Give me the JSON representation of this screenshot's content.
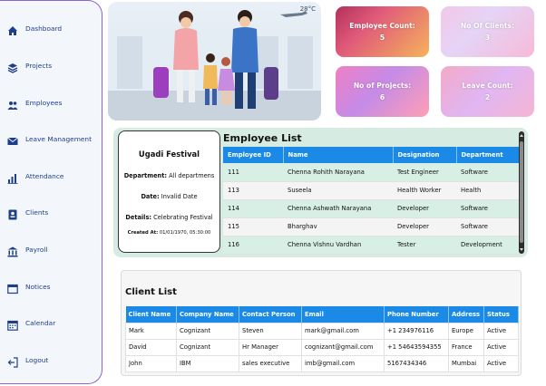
{
  "sidebar": {
    "items": [
      {
        "label": "Dashboard",
        "icon": "home-icon"
      },
      {
        "label": "Projects",
        "icon": "layers-icon"
      },
      {
        "label": "Employees",
        "icon": "users-icon"
      },
      {
        "label": "Leave Management",
        "icon": "envelope-icon"
      },
      {
        "label": "Attendance",
        "icon": "bar-chart-icon"
      },
      {
        "label": "Clients",
        "icon": "id-card-icon"
      },
      {
        "label": "Payroll",
        "icon": "bank-icon"
      },
      {
        "label": "Notices",
        "icon": "window-icon"
      },
      {
        "label": "Calendar",
        "icon": "calendar-icon"
      },
      {
        "label": "Logout",
        "icon": "logout-icon"
      }
    ]
  },
  "hero": {
    "temperature": "28°C"
  },
  "stats": [
    {
      "label": "Employee Count:",
      "value": "5"
    },
    {
      "label": "No Of Clients:",
      "value": "3"
    },
    {
      "label": "No of Projects:",
      "value": "6"
    },
    {
      "label": "Leave Count:",
      "value": "2"
    }
  ],
  "festival": {
    "title": "Ugadi Festival",
    "department_label": "Department:",
    "department": "All departmens",
    "date_label": "Date:",
    "date": "Invalid Date",
    "details_label": "Details:",
    "details": "Celebrating Festival",
    "created_label": "Created At:",
    "created": "01/01/1970, 05:30:00"
  },
  "employees": {
    "title": "Employee List",
    "columns": [
      "Employee ID",
      "Name",
      "Designation",
      "Department"
    ],
    "rows": [
      [
        "111",
        "Chenna Rohith Narayana",
        "Test Engineer",
        "Software"
      ],
      [
        "113",
        "Suseela",
        "Health Worker",
        "Health"
      ],
      [
        "114",
        "Chenna Ashwath Narayana",
        "Developer",
        "Software"
      ],
      [
        "115",
        "Bharghav",
        "Developer",
        "Software"
      ],
      [
        "116",
        "Chenna Vishnu Vardhan",
        "Tester",
        "Development"
      ]
    ]
  },
  "clients": {
    "title": "Client List",
    "columns": [
      "Client Name",
      "Company Name",
      "Contact Person",
      "Email",
      "Phone Number",
      "Address",
      "Status"
    ],
    "rows": [
      [
        "Mark",
        "Cognizant",
        "Steven",
        "mark@gmail.com",
        "+1 234976116",
        "Europe",
        "Active"
      ],
      [
        "David",
        "Cognizant",
        "Hr Manager",
        "cognizant@gmail.com",
        "+1 54643594355",
        "France",
        "Active"
      ],
      [
        "John",
        "IBM",
        "sales executive",
        "imb@gmail.com",
        "5167434346",
        "Mumbai",
        "Active"
      ]
    ]
  },
  "colors": {
    "accent": "#1a8ae6",
    "sidebar_border": "#8b63c9",
    "nav_text": "#1d3f8a",
    "panel_bg": "#d6ece3"
  }
}
